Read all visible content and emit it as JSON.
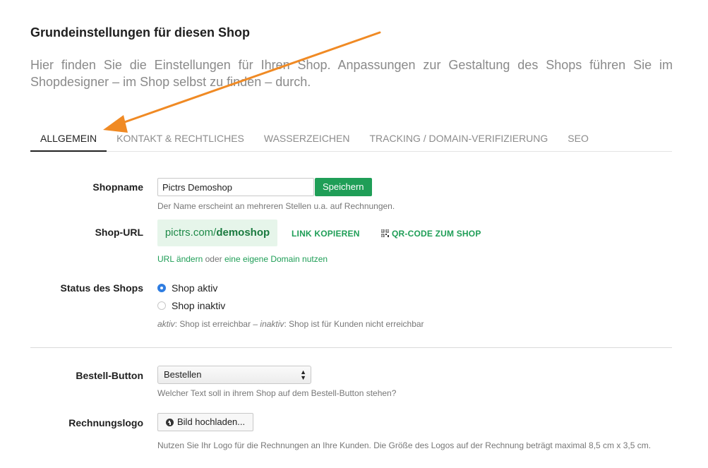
{
  "page": {
    "title": "Grundeinstellungen für diesen Shop",
    "intro": "Hier finden Sie die Einstellungen für Ihren Shop. Anpassungen zur Gestaltung des Shops führen Sie im Shopdesigner – im Shop selbst zu finden – durch."
  },
  "tabs": [
    {
      "label": "ALLGEMEIN",
      "active": true
    },
    {
      "label": "KONTAKT & RECHTLICHES"
    },
    {
      "label": "WASSERZEICHEN"
    },
    {
      "label": "TRACKING / DOMAIN-VERIFIZIERUNG"
    },
    {
      "label": "SEO"
    }
  ],
  "shopname": {
    "label": "Shopname",
    "value": "Pictrs Demoshop",
    "save_label": "Speichern",
    "help": "Der Name erscheint an mehreren Stellen u.a. auf Rechnungen."
  },
  "shop_url": {
    "label": "Shop-URL",
    "domain": "pictrs.com/",
    "slug": "demoshop",
    "copy_label": "LINK KOPIEREN",
    "qr_label": "QR-CODE ZUM SHOP",
    "change_link": "URL ändern",
    "or_text": " oder ",
    "domain_link": "eine eigene Domain nutzen"
  },
  "status": {
    "label": "Status des Shops",
    "option_active": "Shop aktiv",
    "option_inactive": "Shop inaktiv",
    "selected": "Shop aktiv",
    "help_active_term": "aktiv",
    "help_active_text": ": Shop ist erreichbar – ",
    "help_inactive_term": "inaktiv",
    "help_inactive_text": ": Shop ist für Kunden nicht erreichbar"
  },
  "order_button": {
    "label": "Bestell-Button",
    "selected": "Bestellen",
    "help": "Welcher Text soll in ihrem Shop auf dem Bestell-Button stehen?"
  },
  "invoice_logo": {
    "label": "Rechnungslogo",
    "upload_label": "Bild hochladen...",
    "help": "Nutzen Sie Ihr Logo für die Rechnungen an Ihre Kunden. Die Größe des Logos auf der Rechnung beträgt maximal 8,5 cm x 3,5 cm."
  },
  "colors": {
    "accent": "#1f9e57",
    "annotation_arrow": "#f08a24",
    "radio_selected": "#2f7de1"
  }
}
